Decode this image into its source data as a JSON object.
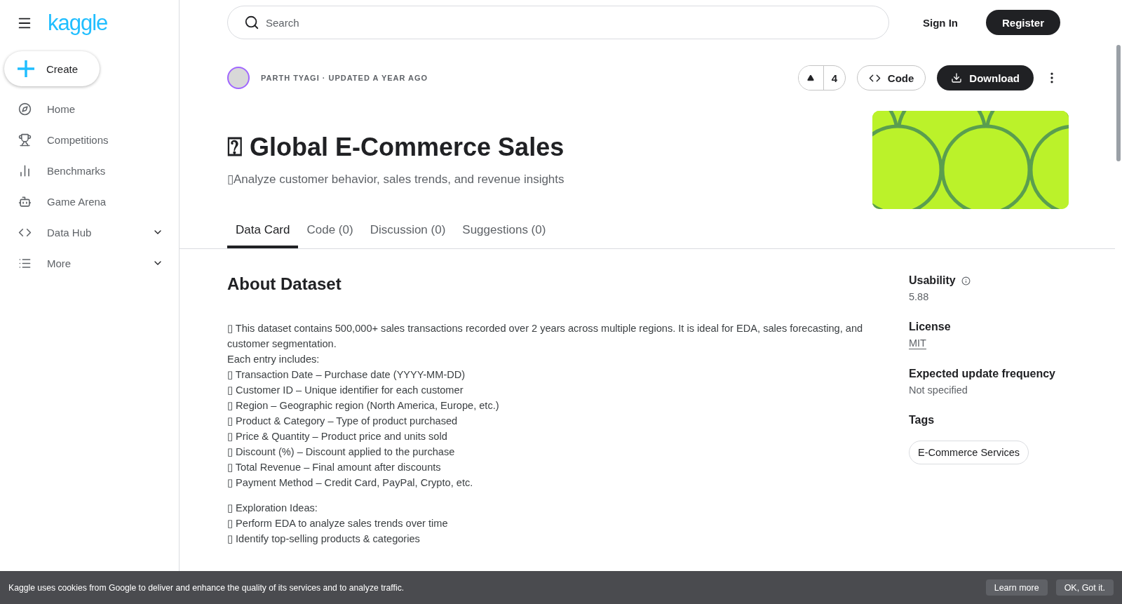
{
  "sidebar": {
    "logo": "kaggle",
    "create": "Create",
    "items": [
      {
        "label": "Home",
        "has_menu": false
      },
      {
        "label": "Competitions",
        "has_menu": false
      },
      {
        "label": "Benchmarks",
        "has_menu": false
      },
      {
        "label": "Game Arena",
        "has_menu": false
      },
      {
        "label": "Data Hub",
        "has_menu": true
      },
      {
        "label": "More",
        "has_menu": true
      }
    ]
  },
  "topbar": {
    "search": {
      "placeholder": "Search"
    },
    "sign_in": "Sign In",
    "register": "Register"
  },
  "dataset": {
    "byline": "PARTH TYAGI · UPDATED A YEAR AGO",
    "votes": "4",
    "code_button": "Code",
    "download_button": "Download",
    "title": "⍰ Global E-Commerce Sales",
    "subtitle": "▯Analyze customer behavior, sales trends, and revenue insights"
  },
  "tabs": [
    {
      "label": "Data Card",
      "selected": true
    },
    {
      "label": "Code (0)",
      "selected": false
    },
    {
      "label": "Discussion (0)",
      "selected": false
    },
    {
      "label": "Suggestions (0)",
      "selected": false
    }
  ],
  "about": {
    "heading": "About Dataset",
    "blocks": [
      [
        "▯ This dataset contains 500,000+ sales transactions recorded over 2 years across multiple regions. It is ideal for EDA, sales forecasting, and customer segmentation.",
        "Each entry includes:",
        "▯ Transaction Date – Purchase date (YYYY-MM-DD)",
        "▯ Customer ID – Unique identifier for each customer",
        "▯ Region – Geographic region (North America, Europe, etc.)",
        "▯ Product & Category – Type of product purchased",
        "▯ Price & Quantity – Product price and units sold",
        "▯ Discount (%) – Discount applied to the purchase",
        "▯ Total Revenue – Final amount after discounts",
        "▯ Payment Method – Credit Card, PayPal, Crypto, etc."
      ],
      [
        "▯ Exploration Ideas:",
        "▯ Perform EDA to analyze sales trends over time",
        "▯ Identify top-selling products & categories"
      ]
    ]
  },
  "meta": {
    "usability": {
      "label": "Usability",
      "value": "5.88"
    },
    "license": {
      "label": "License",
      "value": "MIT"
    },
    "frequency": {
      "label": "Expected update frequency",
      "value": "Not specified"
    },
    "tags": {
      "label": "Tags",
      "items": [
        "E-Commerce Services"
      ]
    }
  },
  "cookie_bar": {
    "text": "Kaggle uses cookies from Google to deliver and enhance the quality of its services and to analyze traffic.",
    "buttons": [
      "Learn more",
      "OK, Got it."
    ]
  }
}
